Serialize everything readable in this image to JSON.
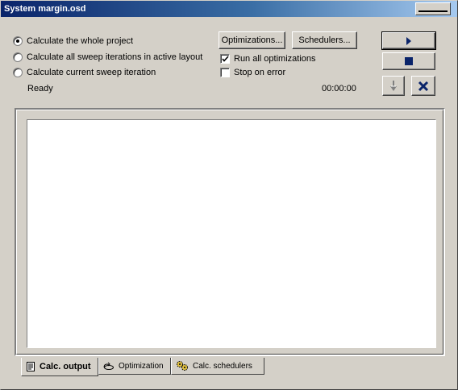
{
  "window": {
    "title": "System margin.osd"
  },
  "calc_mode": {
    "options": [
      {
        "label": "Calculate the whole project",
        "checked": true
      },
      {
        "label": "Calculate all sweep iterations in active layout",
        "checked": false
      },
      {
        "label": "Calculate current sweep iteration",
        "checked": false
      }
    ]
  },
  "buttons": {
    "optimizations": "Optimizations...",
    "schedulers": "Schedulers..."
  },
  "checkboxes": {
    "run_all_optimizations": {
      "label": "Run all optimizations",
      "checked": true
    },
    "stop_on_error": {
      "label": "Stop on error",
      "checked": false
    }
  },
  "status": {
    "text": "Ready",
    "elapsed": "00:00:00"
  },
  "toolbar_icons": {
    "run": "play-icon",
    "stop": "stop-icon",
    "step": "down-arrow-icon",
    "cancel": "close-icon"
  },
  "colors": {
    "icon_navy": "#0a246a",
    "title_start": "#0a246a",
    "title_end": "#a6caf0"
  },
  "tabs": [
    {
      "label": "Calc. output",
      "active": true,
      "icon": "document-icon"
    },
    {
      "label": "Optimization",
      "active": false,
      "icon": "optimization-icon"
    },
    {
      "label": "Calc. schedulers",
      "active": false,
      "icon": "gears-icon"
    }
  ]
}
